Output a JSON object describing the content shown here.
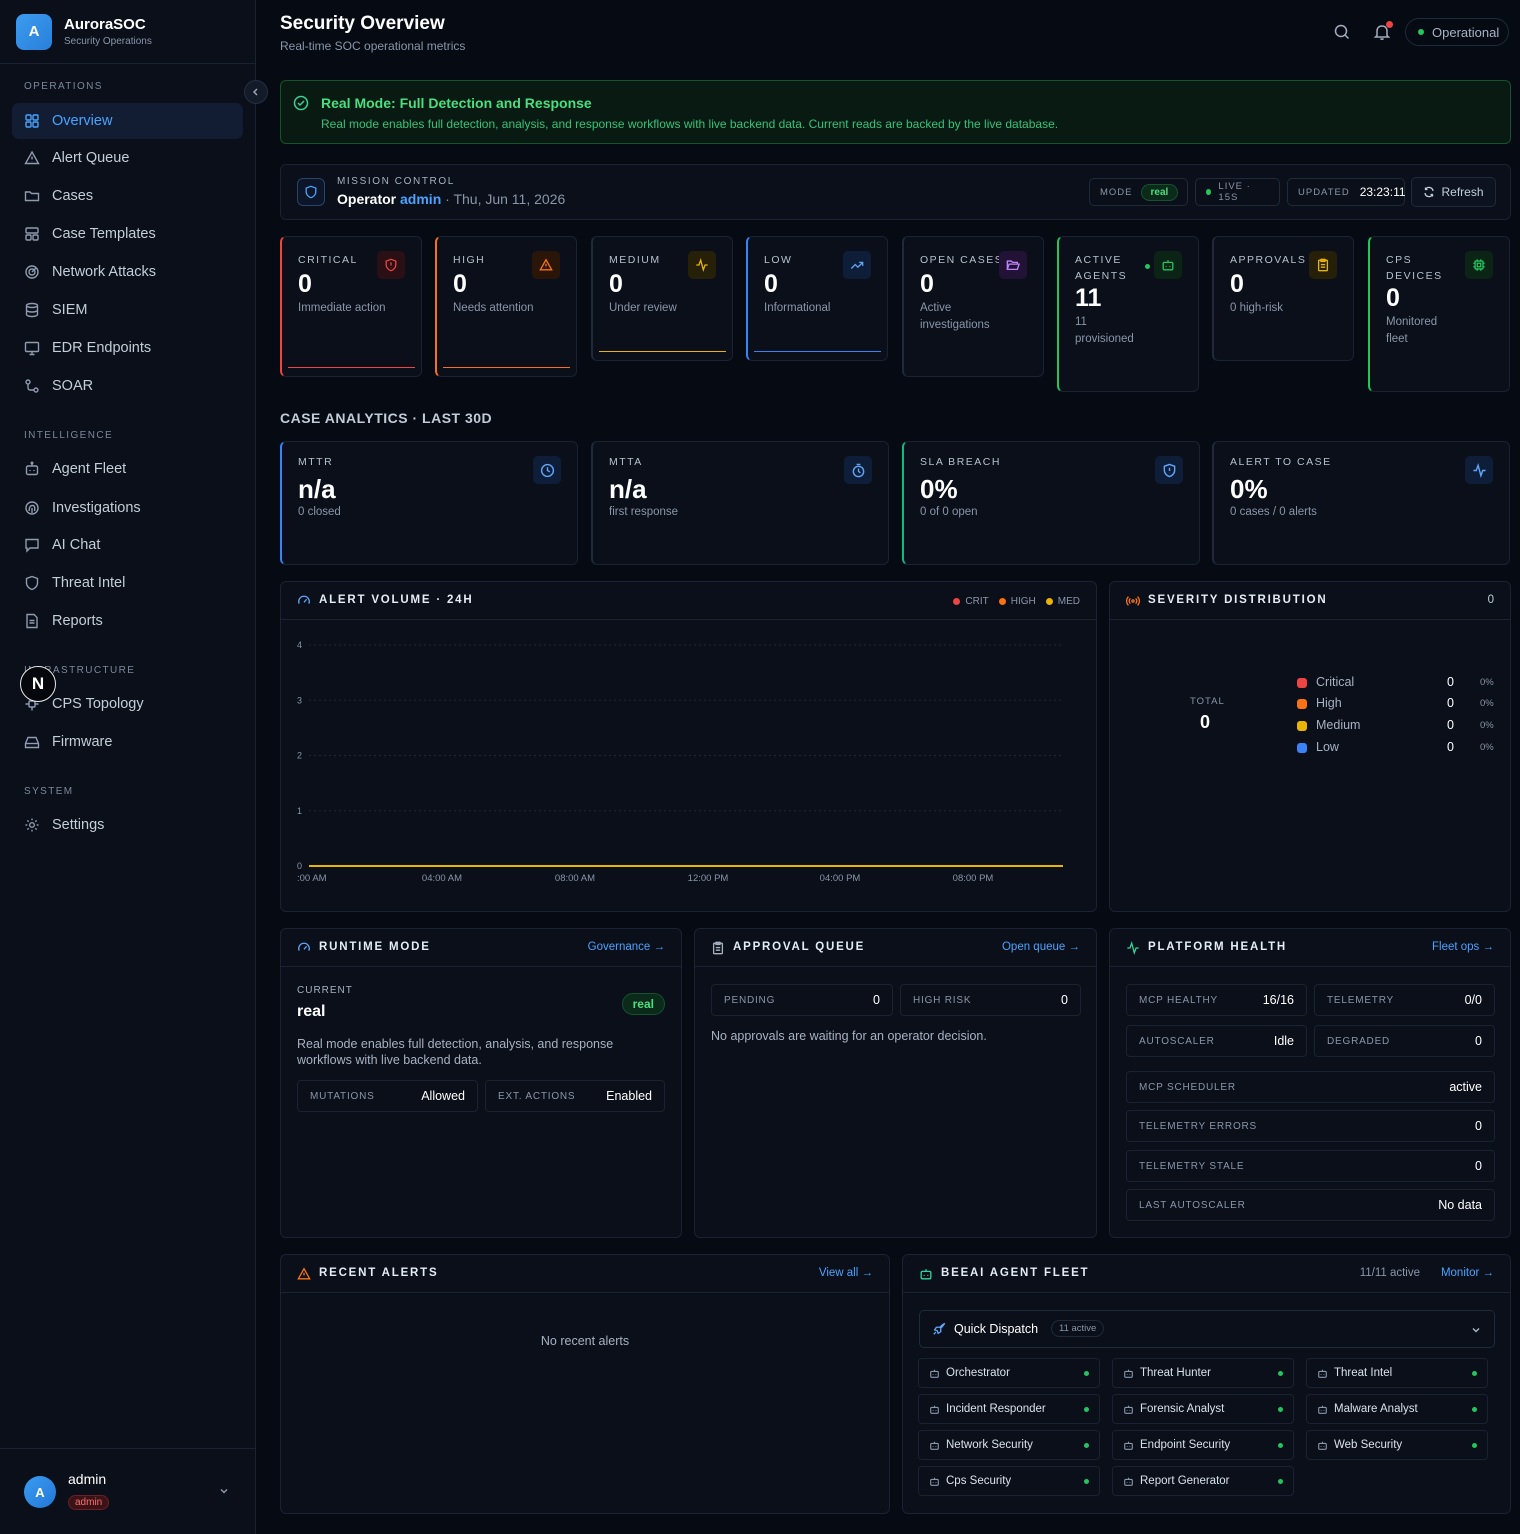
{
  "brand": {
    "logo_letter": "A",
    "name": "AuroraSOC",
    "subtitle": "Security Operations"
  },
  "sidebar": {
    "sections": [
      {
        "label": "OPERATIONS",
        "items": [
          "Overview",
          "Alert Queue",
          "Cases",
          "Case Templates",
          "Network Attacks",
          "SIEM",
          "EDR Endpoints",
          "SOAR"
        ]
      },
      {
        "label": "INTELLIGENCE",
        "items": [
          "Agent Fleet",
          "Investigations",
          "AI Chat",
          "Threat Intel",
          "Reports"
        ]
      },
      {
        "label": "INFRASTRUCTURE",
        "items": [
          "CPS Topology",
          "Firmware"
        ]
      },
      {
        "label": "SYSTEM",
        "items": [
          "Settings"
        ]
      }
    ],
    "active_item": "Overview",
    "overlay_badge": "N"
  },
  "user": {
    "avatar_letter": "A",
    "name": "admin",
    "role": "admin"
  },
  "header": {
    "title": "Security Overview",
    "subtitle": "Real-time SOC operational metrics",
    "status": "Operational"
  },
  "banner": {
    "title": "Real Mode: Full Detection and Response",
    "text": "Real mode enables full detection, analysis, and response workflows with live backend data. Current reads are backed by the live database."
  },
  "mission": {
    "label": "MISSION CONTROL",
    "operator_prefix": "Operator",
    "operator": "admin",
    "date": "· Thu, Jun 11, 2026",
    "mode_label": "MODE",
    "mode_value": "real",
    "live": "LIVE · 15S",
    "updated_label": "UPDATED",
    "updated_value": "23:23:11",
    "refresh": "Refresh"
  },
  "stats": [
    {
      "label": "CRITICAL",
      "value": "0",
      "desc": "Immediate action",
      "color": "#ef4444"
    },
    {
      "label": "HIGH",
      "value": "0",
      "desc": "Needs attention",
      "color": "#f97316"
    },
    {
      "label": "MEDIUM",
      "value": "0",
      "desc": "Under review",
      "color": "#eab308"
    },
    {
      "label": "LOW",
      "value": "0",
      "desc": "Informational",
      "color": "#3b82f6"
    },
    {
      "label": "OPEN CASES",
      "value": "0",
      "desc": "Active investigations",
      "color": "#a855f7"
    },
    {
      "label": "ACTIVE AGENTS",
      "value": "11",
      "desc": "11 provisioned",
      "color": "#22c55e"
    },
    {
      "label": "APPROVALS",
      "value": "0",
      "desc": "0 high-risk",
      "color": "#eab308"
    },
    {
      "label": "CPS DEVICES",
      "value": "0",
      "desc": "Monitored fleet",
      "color": "#22c55e"
    }
  ],
  "analytics": {
    "title": "CASE ANALYTICS · LAST 30D",
    "cards": [
      {
        "label": "MTTR",
        "value": "n/a",
        "desc": "0 closed"
      },
      {
        "label": "MTTA",
        "value": "n/a",
        "desc": "first response"
      },
      {
        "label": "SLA BREACH",
        "value": "0%",
        "desc": "0 of 0 open"
      },
      {
        "label": "ALERT TO CASE",
        "value": "0%",
        "desc": "0 cases / 0 alerts"
      }
    ]
  },
  "alert_volume": {
    "title": "ALERT VOLUME · 24H",
    "legend": [
      "CRIT",
      "HIGH",
      "MED"
    ]
  },
  "chart_data": {
    "type": "line",
    "title": "ALERT VOLUME · 24H",
    "x": [
      ":00 AM",
      "04:00 AM",
      "08:00 AM",
      "12:00 PM",
      "04:00 PM",
      "08:00 PM"
    ],
    "ylim": [
      0,
      4
    ],
    "yticks": [
      "0",
      "1",
      "2",
      "3",
      "4"
    ],
    "series": [
      {
        "name": "CRIT",
        "values": [
          0,
          0,
          0,
          0,
          0,
          0
        ],
        "color": "#ef4444"
      },
      {
        "name": "HIGH",
        "values": [
          0,
          0,
          0,
          0,
          0,
          0
        ],
        "color": "#f97316"
      },
      {
        "name": "MED",
        "values": [
          0,
          0,
          0,
          0,
          0,
          0
        ],
        "color": "#eab308"
      }
    ],
    "grid": true,
    "legend": "top-right"
  },
  "severity": {
    "title": "SEVERITY DISTRIBUTION",
    "count": "0",
    "total_label": "TOTAL",
    "total": "0",
    "rows": [
      {
        "name": "Critical",
        "count": "0",
        "pct": "0%",
        "color": "#ef4444"
      },
      {
        "name": "High",
        "count": "0",
        "pct": "0%",
        "color": "#f97316"
      },
      {
        "name": "Medium",
        "count": "0",
        "pct": "0%",
        "color": "#eab308"
      },
      {
        "name": "Low",
        "count": "0",
        "pct": "0%",
        "color": "#3b82f6"
      }
    ]
  },
  "runtime": {
    "title": "RUNTIME MODE",
    "link": "Governance →",
    "current_label": "CURRENT",
    "current": "real",
    "badge": "real",
    "desc": "Real mode enables full detection, analysis, and response workflows with live backend data.",
    "mutations_label": "MUTATIONS",
    "mutations": "Allowed",
    "ext_label": "EXT. ACTIONS",
    "ext": "Enabled"
  },
  "approval": {
    "title": "APPROVAL QUEUE",
    "link": "Open queue →",
    "pending_label": "PENDING",
    "pending": "0",
    "risk_label": "HIGH RISK",
    "risk": "0",
    "empty": "No approvals are waiting for an operator decision."
  },
  "health": {
    "title": "PLATFORM HEALTH",
    "link": "Fleet ops →",
    "mcp_healthy": {
      "k": "MCP HEALTHY",
      "v": "16/16"
    },
    "telemetry": {
      "k": "TELEMETRY",
      "v": "0/0"
    },
    "autoscaler": {
      "k": "AUTOSCALER",
      "v": "Idle"
    },
    "degraded": {
      "k": "DEGRADED",
      "v": "0"
    },
    "scheduler": {
      "k": "MCP SCHEDULER",
      "v": "active"
    },
    "tel_errors": {
      "k": "TELEMETRY ERRORS",
      "v": "0"
    },
    "tel_stale": {
      "k": "TELEMETRY STALE",
      "v": "0"
    },
    "last_auto": {
      "k": "LAST AUTOSCALER",
      "v": "No data"
    }
  },
  "recent_alerts": {
    "title": "RECENT ALERTS",
    "link": "View all →",
    "empty": "No recent alerts"
  },
  "fleet": {
    "title": "BEEAI AGENT FLEET",
    "active": "11/11 active",
    "link": "Monitor →",
    "dispatch": "Quick Dispatch",
    "dispatch_badge": "11 active",
    "agents": [
      "Orchestrator",
      "Threat Hunter",
      "Threat Intel",
      "Incident Responder",
      "Forensic Analyst",
      "Malware Analyst",
      "Network Security",
      "Endpoint Security",
      "Web Security",
      "Cps Security",
      "Report Generator"
    ]
  }
}
